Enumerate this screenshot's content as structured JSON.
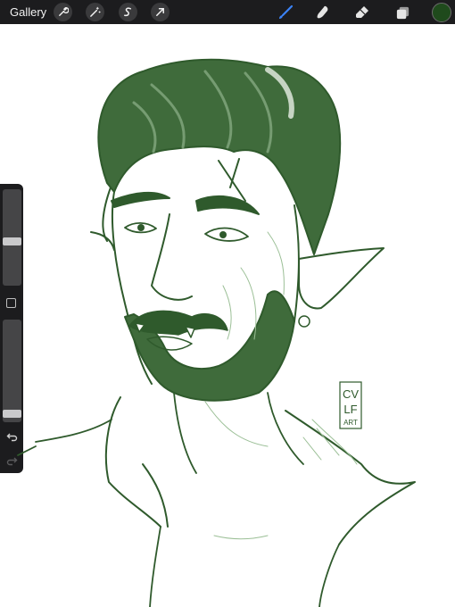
{
  "toolbar": {
    "gallery_label": "Gallery",
    "left_tools": [
      "wrench-icon",
      "magic-wand-icon",
      "selection-icon",
      "transform-arrow-icon"
    ],
    "right_tools": [
      "brush-icon",
      "smudge-icon",
      "eraser-icon",
      "layers-icon"
    ],
    "active_tool": "brush-icon",
    "accent_color": "#3b82f6",
    "current_color": "#1f4a1c"
  },
  "sidebar": {
    "brush_size_level": 0.45,
    "opacity_level": 0.05
  },
  "artwork": {
    "signature_lines": [
      "CV",
      "LF",
      "ART"
    ],
    "ink_color": "#2f5a2c",
    "shade_color": "#4b7a47"
  }
}
